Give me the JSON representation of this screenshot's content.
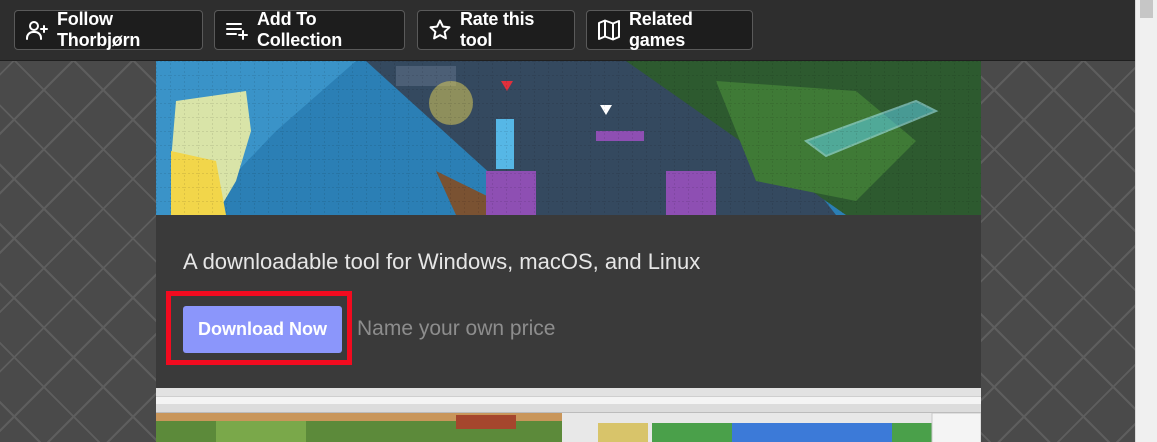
{
  "toolbar": {
    "follow_label": "Follow Thorbjørn",
    "collection_label": "Add To Collection",
    "rate_label": "Rate this tool",
    "related_label": "Related games"
  },
  "icons": {
    "follow": "user-plus-icon",
    "collection": "playlist-add-icon",
    "rate": "star-icon",
    "related": "map-icon"
  },
  "product": {
    "tagline": "A downloadable tool for Windows, macOS, and Linux",
    "download_label": "Download Now",
    "price_hint": "Name your own price"
  },
  "colors": {
    "accent": "#8b96fb",
    "highlight_box": "#f20b1f",
    "page_background": "#4a4a4a",
    "panel": "#3a3a3a",
    "topbar": "#2e2e2e"
  }
}
